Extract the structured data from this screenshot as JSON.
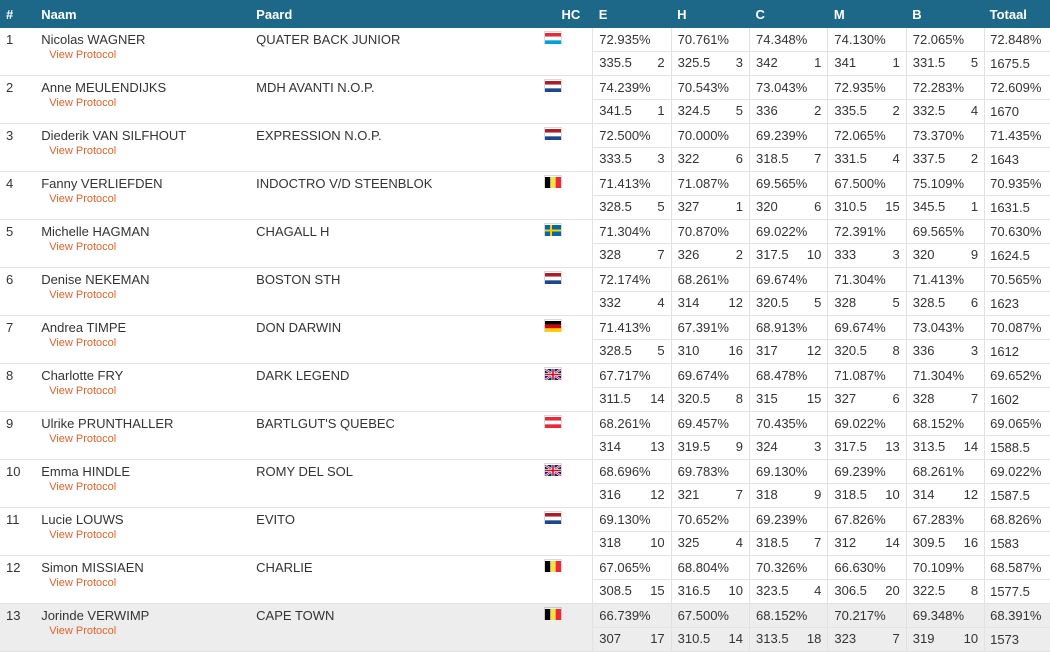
{
  "headers": {
    "rank": "#",
    "name": "Naam",
    "horse": "Paard",
    "hc": "HC",
    "e": "E",
    "h": "H",
    "c": "C",
    "m": "M",
    "b": "B",
    "total": "Totaal"
  },
  "protocol_label": "View Protocol",
  "rows": [
    {
      "rank": "1",
      "name": "Nicolas WAGNER",
      "horse": "QUATER BACK JUNIOR",
      "flag": "LUX",
      "judges": [
        {
          "pct": "72.935%",
          "pts": "335.5",
          "pos": "2"
        },
        {
          "pct": "70.761%",
          "pts": "325.5",
          "pos": "3"
        },
        {
          "pct": "74.348%",
          "pts": "342",
          "pos": "1"
        },
        {
          "pct": "74.130%",
          "pts": "341",
          "pos": "1"
        },
        {
          "pct": "72.065%",
          "pts": "331.5",
          "pos": "5"
        }
      ],
      "total_pct": "72.848%",
      "total_pts": "1675.5"
    },
    {
      "rank": "2",
      "name": "Anne MEULENDIJKS",
      "horse": "MDH AVANTI N.O.P.",
      "flag": "NED",
      "judges": [
        {
          "pct": "74.239%",
          "pts": "341.5",
          "pos": "1"
        },
        {
          "pct": "70.543%",
          "pts": "324.5",
          "pos": "5"
        },
        {
          "pct": "73.043%",
          "pts": "336",
          "pos": "2"
        },
        {
          "pct": "72.935%",
          "pts": "335.5",
          "pos": "2"
        },
        {
          "pct": "72.283%",
          "pts": "332.5",
          "pos": "4"
        }
      ],
      "total_pct": "72.609%",
      "total_pts": "1670"
    },
    {
      "rank": "3",
      "name": "Diederik VAN SILFHOUT",
      "horse": "EXPRESSION N.O.P.",
      "flag": "NED",
      "judges": [
        {
          "pct": "72.500%",
          "pts": "333.5",
          "pos": "3"
        },
        {
          "pct": "70.000%",
          "pts": "322",
          "pos": "6"
        },
        {
          "pct": "69.239%",
          "pts": "318.5",
          "pos": "7"
        },
        {
          "pct": "72.065%",
          "pts": "331.5",
          "pos": "4"
        },
        {
          "pct": "73.370%",
          "pts": "337.5",
          "pos": "2"
        }
      ],
      "total_pct": "71.435%",
      "total_pts": "1643"
    },
    {
      "rank": "4",
      "name": "Fanny VERLIEFDEN",
      "horse": "INDOCTRO V/D STEENBLOK",
      "flag": "BEL",
      "judges": [
        {
          "pct": "71.413%",
          "pts": "328.5",
          "pos": "5"
        },
        {
          "pct": "71.087%",
          "pts": "327",
          "pos": "1"
        },
        {
          "pct": "69.565%",
          "pts": "320",
          "pos": "6"
        },
        {
          "pct": "67.500%",
          "pts": "310.5",
          "pos": "15"
        },
        {
          "pct": "75.109%",
          "pts": "345.5",
          "pos": "1"
        }
      ],
      "total_pct": "70.935%",
      "total_pts": "1631.5"
    },
    {
      "rank": "5",
      "name": "Michelle HAGMAN",
      "horse": "CHAGALL H",
      "flag": "SWE",
      "judges": [
        {
          "pct": "71.304%",
          "pts": "328",
          "pos": "7"
        },
        {
          "pct": "70.870%",
          "pts": "326",
          "pos": "2"
        },
        {
          "pct": "69.022%",
          "pts": "317.5",
          "pos": "10"
        },
        {
          "pct": "72.391%",
          "pts": "333",
          "pos": "3"
        },
        {
          "pct": "69.565%",
          "pts": "320",
          "pos": "9"
        }
      ],
      "total_pct": "70.630%",
      "total_pts": "1624.5"
    },
    {
      "rank": "6",
      "name": "Denise NEKEMAN",
      "horse": "BOSTON STH",
      "flag": "NED",
      "judges": [
        {
          "pct": "72.174%",
          "pts": "332",
          "pos": "4"
        },
        {
          "pct": "68.261%",
          "pts": "314",
          "pos": "12"
        },
        {
          "pct": "69.674%",
          "pts": "320.5",
          "pos": "5"
        },
        {
          "pct": "71.304%",
          "pts": "328",
          "pos": "5"
        },
        {
          "pct": "71.413%",
          "pts": "328.5",
          "pos": "6"
        }
      ],
      "total_pct": "70.565%",
      "total_pts": "1623"
    },
    {
      "rank": "7",
      "name": "Andrea TIMPE",
      "horse": "DON DARWIN",
      "flag": "GER",
      "judges": [
        {
          "pct": "71.413%",
          "pts": "328.5",
          "pos": "5"
        },
        {
          "pct": "67.391%",
          "pts": "310",
          "pos": "16"
        },
        {
          "pct": "68.913%",
          "pts": "317",
          "pos": "12"
        },
        {
          "pct": "69.674%",
          "pts": "320.5",
          "pos": "8"
        },
        {
          "pct": "73.043%",
          "pts": "336",
          "pos": "3"
        }
      ],
      "total_pct": "70.087%",
      "total_pts": "1612"
    },
    {
      "rank": "8",
      "name": "Charlotte FRY",
      "horse": "DARK LEGEND",
      "flag": "GBR",
      "judges": [
        {
          "pct": "67.717%",
          "pts": "311.5",
          "pos": "14"
        },
        {
          "pct": "69.674%",
          "pts": "320.5",
          "pos": "8"
        },
        {
          "pct": "68.478%",
          "pts": "315",
          "pos": "15"
        },
        {
          "pct": "71.087%",
          "pts": "327",
          "pos": "6"
        },
        {
          "pct": "71.304%",
          "pts": "328",
          "pos": "7"
        }
      ],
      "total_pct": "69.652%",
      "total_pts": "1602"
    },
    {
      "rank": "9",
      "name": "Ulrike PRUNTHALLER",
      "horse": "BARTLGUT'S QUEBEC",
      "flag": "AUT",
      "judges": [
        {
          "pct": "68.261%",
          "pts": "314",
          "pos": "13"
        },
        {
          "pct": "69.457%",
          "pts": "319.5",
          "pos": "9"
        },
        {
          "pct": "70.435%",
          "pts": "324",
          "pos": "3"
        },
        {
          "pct": "69.022%",
          "pts": "317.5",
          "pos": "13"
        },
        {
          "pct": "68.152%",
          "pts": "313.5",
          "pos": "14"
        }
      ],
      "total_pct": "69.065%",
      "total_pts": "1588.5"
    },
    {
      "rank": "10",
      "name": "Emma HINDLE",
      "horse": "ROMY DEL SOL",
      "flag": "GBR",
      "judges": [
        {
          "pct": "68.696%",
          "pts": "316",
          "pos": "12"
        },
        {
          "pct": "69.783%",
          "pts": "321",
          "pos": "7"
        },
        {
          "pct": "69.130%",
          "pts": "318",
          "pos": "9"
        },
        {
          "pct": "69.239%",
          "pts": "318.5",
          "pos": "10"
        },
        {
          "pct": "68.261%",
          "pts": "314",
          "pos": "12"
        }
      ],
      "total_pct": "69.022%",
      "total_pts": "1587.5"
    },
    {
      "rank": "11",
      "name": "Lucie LOUWS",
      "horse": "EVITO",
      "flag": "NED",
      "judges": [
        {
          "pct": "69.130%",
          "pts": "318",
          "pos": "10"
        },
        {
          "pct": "70.652%",
          "pts": "325",
          "pos": "4"
        },
        {
          "pct": "69.239%",
          "pts": "318.5",
          "pos": "7"
        },
        {
          "pct": "67.826%",
          "pts": "312",
          "pos": "14"
        },
        {
          "pct": "67.283%",
          "pts": "309.5",
          "pos": "16"
        }
      ],
      "total_pct": "68.826%",
      "total_pts": "1583"
    },
    {
      "rank": "12",
      "name": "Simon MISSIAEN",
      "horse": "CHARLIE",
      "flag": "BEL",
      "judges": [
        {
          "pct": "67.065%",
          "pts": "308.5",
          "pos": "15"
        },
        {
          "pct": "68.804%",
          "pts": "316.5",
          "pos": "10"
        },
        {
          "pct": "70.326%",
          "pts": "323.5",
          "pos": "4"
        },
        {
          "pct": "66.630%",
          "pts": "306.5",
          "pos": "20"
        },
        {
          "pct": "70.109%",
          "pts": "322.5",
          "pos": "8"
        }
      ],
      "total_pct": "68.587%",
      "total_pts": "1577.5"
    },
    {
      "rank": "13",
      "name": "Jorinde VERWIMP",
      "horse": "CAPE TOWN",
      "flag": "BEL",
      "judges": [
        {
          "pct": "66.739%",
          "pts": "307",
          "pos": "17"
        },
        {
          "pct": "67.500%",
          "pts": "310.5",
          "pos": "14"
        },
        {
          "pct": "68.152%",
          "pts": "313.5",
          "pos": "18"
        },
        {
          "pct": "70.217%",
          "pts": "323",
          "pos": "7"
        },
        {
          "pct": "69.348%",
          "pts": "319",
          "pos": "10"
        }
      ],
      "total_pct": "68.391%",
      "total_pts": "1573"
    }
  ],
  "highlight_rank": "13",
  "colors": {
    "header_bg": "#1d6788",
    "protocol_link": "#e2632a",
    "row_highlight": "#ededed"
  }
}
